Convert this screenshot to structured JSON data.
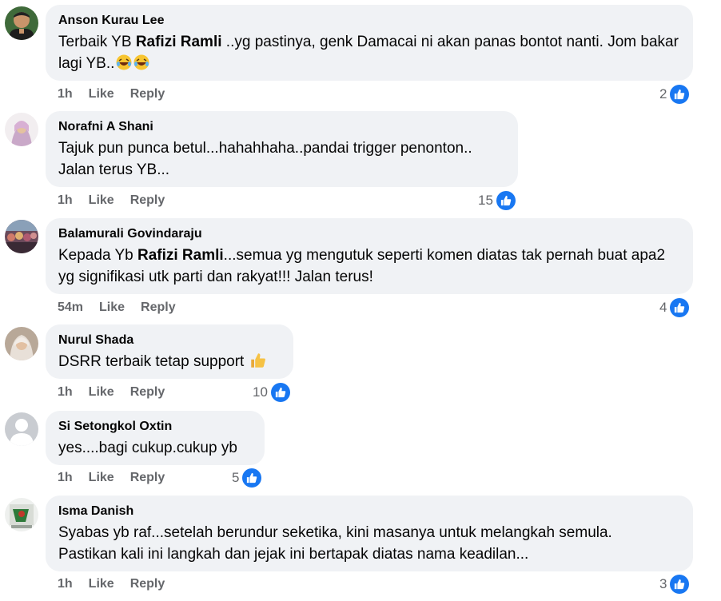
{
  "comments": [
    {
      "name": "Anson Kurau Lee",
      "text_a": "Terbaik YB ",
      "bold": "Rafizi Ramli",
      "text_b": " ..yg pastinya, genk Damacai ni akan panas bontot nanti. Jom bakar lagi YB..",
      "emoji": [
        "laughing-emoji",
        "laughing-emoji"
      ],
      "time": "1h",
      "like": "Like",
      "reply": "Reply",
      "reactions": "2"
    },
    {
      "name": "Norafni A Shani",
      "text_a": "Tajuk pun punca betul...hahahhaha..pandai trigger penonton..\nJalan terus YB...",
      "time": "1h",
      "like": "Like",
      "reply": "Reply",
      "reactions": "15"
    },
    {
      "name": "Balamurali Govindaraju",
      "text_a": "Kepada Yb ",
      "bold": "Rafizi Ramli",
      "text_b": "...semua yg mengutuk seperti komen diatas tak pernah buat apa2 yg signifikasi utk parti dan rakyat!!! Jalan terus!",
      "time": "54m",
      "like": "Like",
      "reply": "Reply",
      "reactions": "4"
    },
    {
      "name": "Nurul Shada",
      "text_a": "DSRR terbaik tetap support ",
      "emoji": [
        "thumbs-up-emoji"
      ],
      "time": "1h",
      "like": "Like",
      "reply": "Reply",
      "reactions": "10"
    },
    {
      "name": "Si Setongkol Oxtin",
      "text_a": "yes....bagi cukup.cukup yb",
      "time": "1h",
      "like": "Like",
      "reply": "Reply",
      "reactions": "5"
    },
    {
      "name": "Isma Danish",
      "text_a": "Syabas yb raf...setelah berundur seketika, kini masanya untuk melangkah semula.\nPastikan kali ini langkah dan jejak ini bertapak diatas nama keadilan...",
      "time": "1h",
      "like": "Like",
      "reply": "Reply",
      "reactions": "3"
    }
  ],
  "colors": {
    "bubble": "#f0f2f5",
    "meta": "#65676b",
    "like_blue": "#1877f2"
  }
}
